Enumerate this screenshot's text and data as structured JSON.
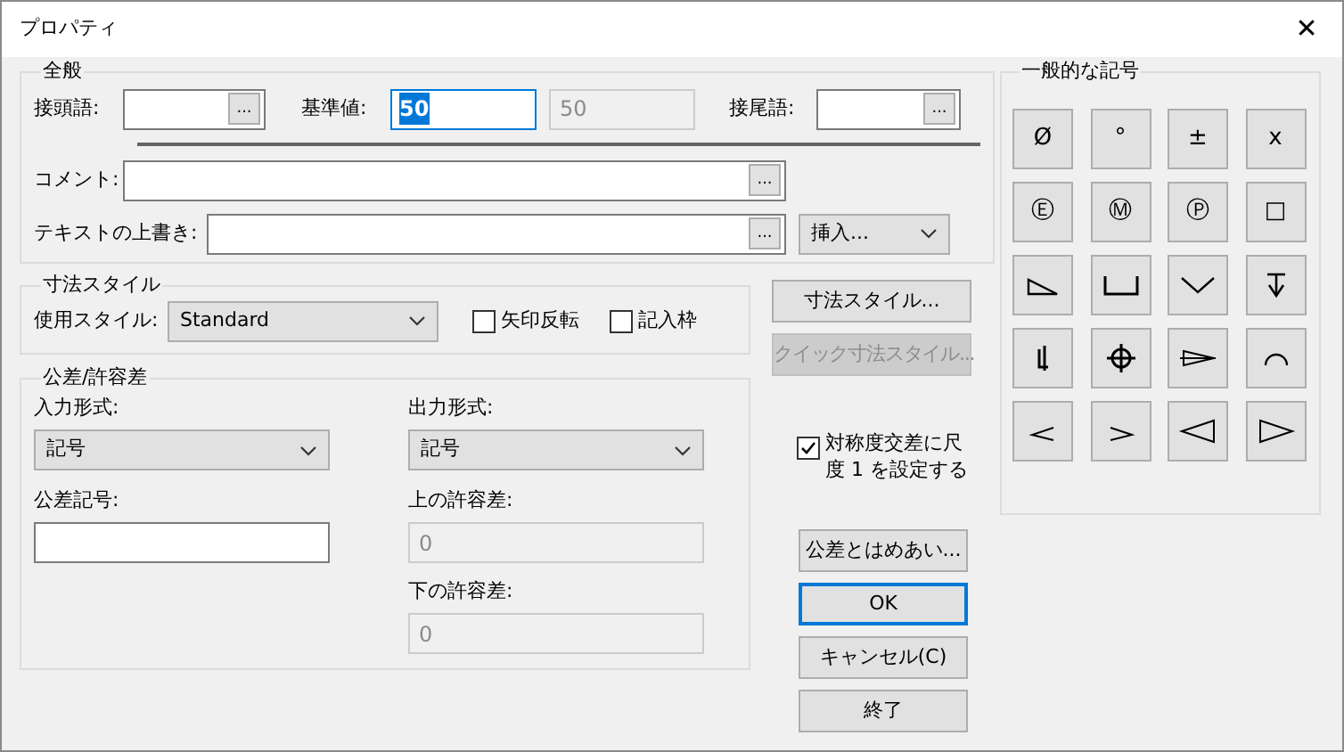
{
  "window": {
    "title": "プロパティ",
    "close": "✕"
  },
  "general": {
    "title": "全般",
    "prefix": {
      "label": "接頭語:",
      "browse": "..."
    },
    "base_value": {
      "label": "基準値:",
      "value": "50",
      "selected": true
    },
    "base_display": {
      "value": "50",
      "disabled": true
    },
    "suffix": {
      "label": "接尾語:",
      "browse": "..."
    },
    "comment": {
      "label": "コメント:",
      "browse": "..."
    },
    "text_override": {
      "label": "テキストの上書き:",
      "browse": "..."
    },
    "insert_dropdown": {
      "value": "挿入..."
    }
  },
  "dimension_style": {
    "title": "寸法スタイル",
    "style_label": "使用スタイル:",
    "style_value": "Standard",
    "checkboxes": [
      {
        "label": "矢印反転",
        "checked": false
      },
      {
        "label": "記入枠",
        "checked": false
      }
    ]
  },
  "side_buttons": [
    {
      "label": "寸法スタイル...",
      "disabled": false
    },
    {
      "label": "クイック寸法スタイル...",
      "disabled": true
    }
  ],
  "tolerance": {
    "title": "公差/許容差",
    "input_format": {
      "label": "入力形式:",
      "value": "記号"
    },
    "output_format": {
      "label": "出力形式:",
      "value": "記号"
    },
    "tolerance_symbol": {
      "label": "公差記号:"
    },
    "upper": {
      "label": "上の許容差:",
      "value": "0",
      "disabled": true
    },
    "lower": {
      "label": "下の許容差:",
      "value": "0",
      "disabled": true
    }
  },
  "symmetric_checkbox": {
    "label": "対称度交差に尺度 1 を設定する",
    "checked": true
  },
  "action_buttons": [
    {
      "label": "公差とはめあい...",
      "default": false
    },
    {
      "label": "OK",
      "default": true
    },
    {
      "label": "キャンセル(C)",
      "default": false
    },
    {
      "label": "終了",
      "default": false
    }
  ],
  "symbols": {
    "title": "一般的な記号",
    "items": [
      {
        "kind": "char",
        "label": "Ø"
      },
      {
        "kind": "char",
        "label": "°"
      },
      {
        "kind": "char",
        "label": "±"
      },
      {
        "kind": "char",
        "label": "x"
      },
      {
        "kind": "char",
        "label": "Ⓔ"
      },
      {
        "kind": "char",
        "label": "Ⓜ"
      },
      {
        "kind": "char",
        "label": "Ⓟ"
      },
      {
        "kind": "char",
        "label": "□"
      },
      {
        "kind": "icon"
      },
      {
        "kind": "icon"
      },
      {
        "kind": "icon"
      },
      {
        "kind": "icon"
      },
      {
        "kind": "icon"
      },
      {
        "kind": "icon"
      },
      {
        "kind": "icon"
      },
      {
        "kind": "icon"
      },
      {
        "kind": "icon"
      },
      {
        "kind": "icon"
      },
      {
        "kind": "icon"
      },
      {
        "kind": "icon"
      }
    ]
  }
}
